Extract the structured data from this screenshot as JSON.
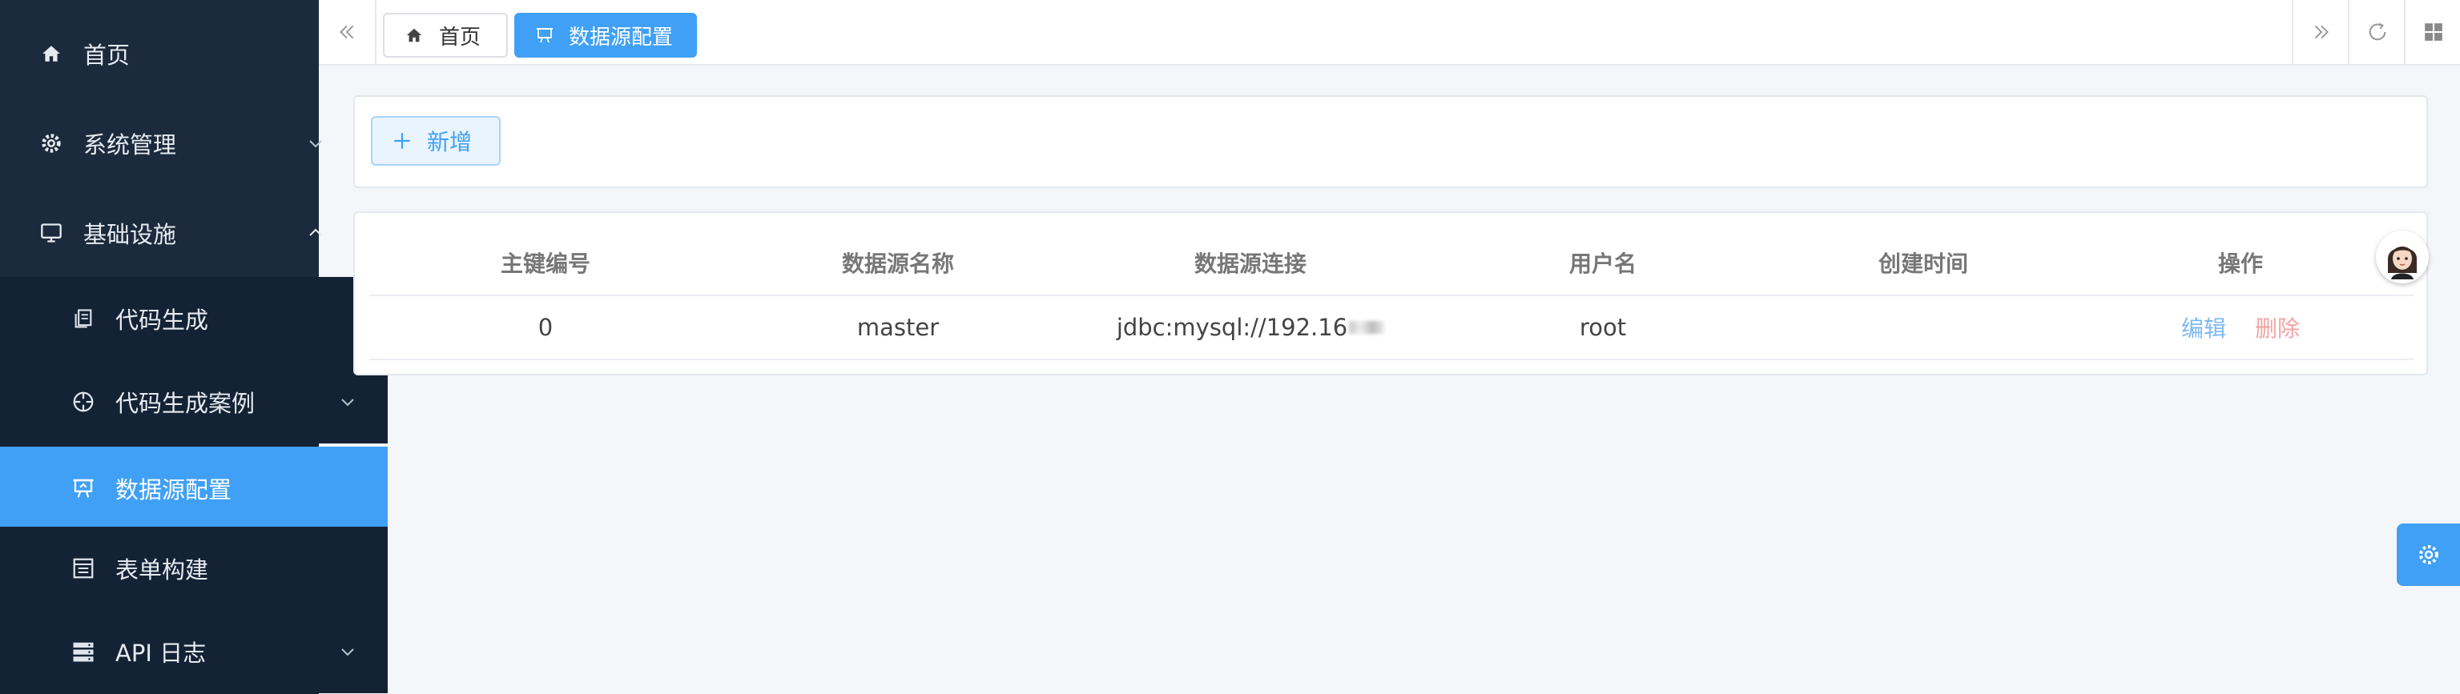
{
  "sidebar": {
    "items": [
      {
        "label": "首页",
        "icon": "home-icon"
      },
      {
        "label": "系统管理",
        "icon": "gear-icon"
      },
      {
        "label": "基础设施",
        "icon": "monitor-icon"
      },
      {
        "label": "代码生成",
        "icon": "document-copy-icon"
      },
      {
        "label": "代码生成案例",
        "icon": "crosshair-icon"
      },
      {
        "label": "数据源配置",
        "icon": "presentation-icon"
      },
      {
        "label": "表单构建",
        "icon": "form-icon"
      },
      {
        "label": "API 日志",
        "icon": "server-icon"
      }
    ]
  },
  "tabs": [
    {
      "label": "首页",
      "icon": "home-icon"
    },
    {
      "label": "数据源配置",
      "icon": "presentation-icon"
    }
  ],
  "toolbar": {
    "add_label": "新增"
  },
  "table": {
    "headers": [
      "主键编号",
      "数据源名称",
      "数据源连接",
      "用户名",
      "创建时间",
      "操作"
    ],
    "rows": [
      {
        "id": "0",
        "name": "master",
        "url": "jdbc:mysql://192.16",
        "username": "root",
        "created": ""
      }
    ],
    "actions": {
      "edit": "编辑",
      "delete": "删除"
    }
  },
  "colors": {
    "accent": "#40a0f5",
    "sidebar_bg": "#1b2a3c",
    "submenu_bg": "#142235"
  }
}
